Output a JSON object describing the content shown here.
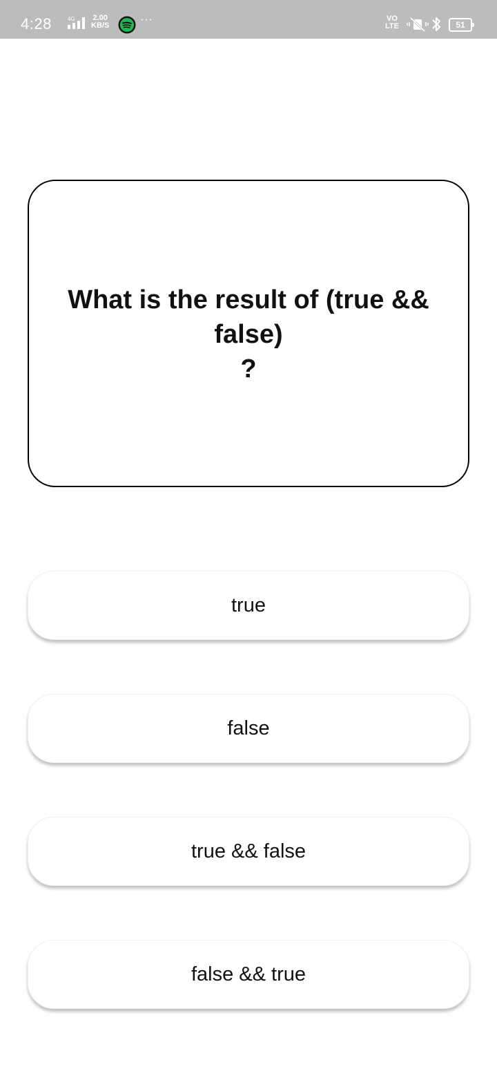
{
  "status_bar": {
    "time": "4:28",
    "network_type": "4G",
    "speed_value": "2.00",
    "speed_unit": "KB/S",
    "more": "···",
    "volte_top": "VO",
    "volte_bottom": "LTE",
    "battery": "51",
    "icons": [
      "signal-icon",
      "spotify-icon",
      "mute-icon",
      "bluetooth-icon",
      "battery-icon"
    ]
  },
  "question": {
    "text": "What is the result of (true &&\nfalse)\n?"
  },
  "answers": [
    {
      "label": "true"
    },
    {
      "label": "false"
    },
    {
      "label": "true && false"
    },
    {
      "label": "false && true"
    }
  ],
  "colors": {
    "status_bar": "#bcbcbc",
    "background": "#ffffff",
    "text": "#111111",
    "spotify": "#1db954"
  }
}
